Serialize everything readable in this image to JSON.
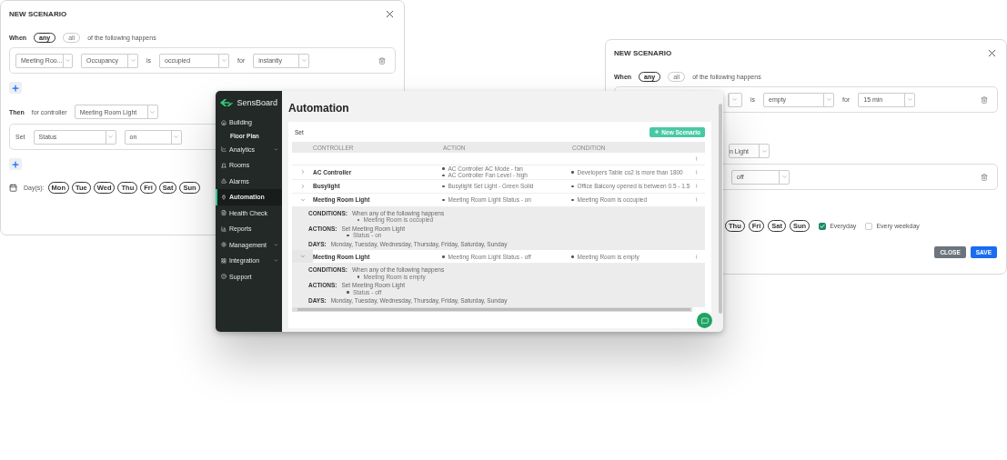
{
  "left_dialog": {
    "title": "NEW SCENARIO",
    "when_label": "When",
    "match_options": [
      {
        "label": "any",
        "selected": true
      },
      {
        "label": "all",
        "selected": false
      }
    ],
    "match_text": "of the following happens",
    "condition": [
      {
        "kind": "select",
        "value": "Meeting Roo..."
      },
      {
        "kind": "select",
        "value": "Occupancy"
      },
      {
        "kind": "text",
        "value": "is"
      },
      {
        "kind": "select",
        "value": "occupied"
      },
      {
        "kind": "text",
        "value": "for"
      },
      {
        "kind": "select",
        "value": "instantly"
      }
    ],
    "then_label": "Then",
    "controller_label": "for controller",
    "controller": "Meeting Room Light",
    "action": [
      {
        "kind": "text",
        "value": "Set"
      },
      {
        "kind": "select",
        "value": "Status"
      },
      {
        "kind": "select",
        "value": "on"
      }
    ],
    "days_label": "Day(s):",
    "days": [
      {
        "label": "Mon",
        "selected": true
      },
      {
        "label": "Tue",
        "selected": true
      },
      {
        "label": "Wed",
        "selected": true
      },
      {
        "label": "Thu",
        "selected": true
      },
      {
        "label": "Fri",
        "selected": true
      },
      {
        "label": "Sat",
        "selected": true
      },
      {
        "label": "Sun",
        "selected": true
      }
    ]
  },
  "right_dialog": {
    "title": "NEW SCENARIO",
    "when_label": "When",
    "match_options": [
      {
        "label": "any",
        "selected": true
      },
      {
        "label": "all",
        "selected": false
      }
    ],
    "match_text": "of the following happens",
    "condition": [
      {
        "kind": "stub"
      },
      {
        "kind": "text",
        "value": "is"
      },
      {
        "kind": "select",
        "value": "empty"
      },
      {
        "kind": "text",
        "value": "for"
      },
      {
        "kind": "select",
        "value": "15 min"
      }
    ],
    "controller": "n Light",
    "action": [
      {
        "kind": "select",
        "value": "off"
      }
    ],
    "days": [
      {
        "label": "Thu",
        "selected": true
      },
      {
        "label": "Fri",
        "selected": true
      },
      {
        "label": "Sat",
        "selected": true
      },
      {
        "label": "Sun",
        "selected": true
      }
    ],
    "repeat": [
      {
        "label": "Everyday",
        "checked": true
      },
      {
        "label": "Every weekday",
        "checked": false
      }
    ],
    "buttons": [
      {
        "label": "CLOSE",
        "kind": "secondary"
      },
      {
        "label": "SAVE",
        "kind": "primary"
      }
    ]
  },
  "app": {
    "brand": "SensBoard",
    "sidebar": [
      {
        "label": "Building",
        "selected": false,
        "expandable": false,
        "children": [
          {
            "label": "Floor Plan",
            "selected": false
          }
        ]
      },
      {
        "label": "Analytics",
        "selected": false,
        "expandable": true
      },
      {
        "label": "Rooms",
        "selected": false,
        "expandable": false
      },
      {
        "label": "Alarms",
        "selected": false,
        "expandable": false
      },
      {
        "label": "Automation",
        "selected": true,
        "expandable": false
      },
      {
        "label": "Health Check",
        "selected": false,
        "expandable": false
      },
      {
        "label": "Reports",
        "selected": false,
        "expandable": false
      },
      {
        "label": "Management",
        "selected": false,
        "expandable": true
      },
      {
        "label": "Integration",
        "selected": false,
        "expandable": true
      },
      {
        "label": "Support",
        "selected": false,
        "expandable": false
      }
    ],
    "page_title": "Automation",
    "filter_label": "Set",
    "new_button": "New Scenario",
    "table": {
      "columns": [
        "CONTROLLER",
        "ACTION",
        "CONDITION"
      ],
      "rows": [
        {
          "kind": "blank"
        },
        {
          "kind": "rule",
          "controller": "AC Controller",
          "expanded": false,
          "hovered": false,
          "actions": [
            "AC Controller AC Mode - fan",
            "AC Controller Fan Level - high"
          ],
          "conditions": [
            "Developers Table co2 is more than 1800"
          ]
        },
        {
          "kind": "rule",
          "controller": "Busylight",
          "expanded": false,
          "hovered": false,
          "actions": [
            "Busylight Set Light - Green Solid"
          ],
          "conditions": [
            "Office Balcony opened is between 0.5 - 1.5"
          ]
        },
        {
          "kind": "rule",
          "controller": "Meeting Room Light",
          "expanded": true,
          "hovered": false,
          "actions": [
            "Meeting Room Light Status - on"
          ],
          "conditions": [
            "Meeting Room is occupied"
          ],
          "details": {
            "conditions_label": "CONDITIONS:",
            "conditions_text": "When any of the following happens",
            "conditions_items": [
              "Meeting Room is occupied"
            ],
            "actions_label": "ACTIONS:",
            "actions_text": "Set Meeting Room Light",
            "actions_items": [
              "Status - on"
            ],
            "days_label": "DAYS:",
            "days_text": "Monday, Tuesday, Wednesday, Thursday, Friday, Saturday, Sunday"
          }
        },
        {
          "kind": "rule",
          "controller": "Meeting Room Light",
          "expanded": true,
          "hovered": true,
          "actions": [
            "Meeting Room Light Status - off"
          ],
          "conditions": [
            "Meeting Room is empty"
          ],
          "details": {
            "conditions_label": "CONDITIONS:",
            "conditions_text": "When any of the following happens",
            "conditions_items": [
              "Meeting Room is empty"
            ],
            "actions_label": "ACTIONS:",
            "actions_text": "Set Meeting Room Light",
            "actions_items": [
              "Status - off"
            ],
            "days_label": "DAYS:",
            "days_text": "Monday, Tuesday, Wednesday, Thursday, Friday, Saturday, Sunday"
          }
        }
      ]
    }
  }
}
